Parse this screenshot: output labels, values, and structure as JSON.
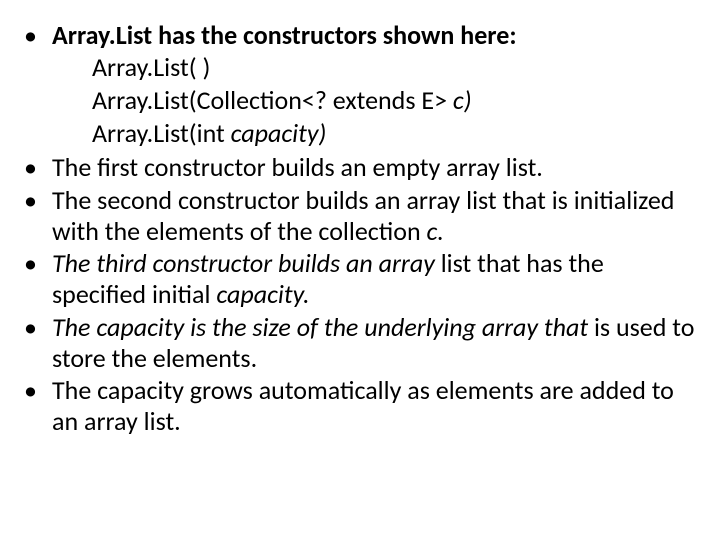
{
  "bullets": {
    "b0": {
      "lead_bold": "Array.",
      "lead_rest": "List has the constructors shown here:",
      "sub1_a": "Array.",
      "sub1_b": "List( )",
      "sub2_a": "Array.",
      "sub2_b": "List(Collection<? extends E> ",
      "sub2_c": "c)",
      "sub3_a": "Array.",
      "sub3_b": "List(int ",
      "sub3_c": "capacity)"
    },
    "b1": "The first constructor builds an empty array list.",
    "b2": {
      "a": "The second constructor builds an array list that is initialized with the elements of the collection ",
      "b": "c."
    },
    "b3": {
      "a": "The third constructor builds an array ",
      "b": "list that has the specified initial ",
      "c": "capacity."
    },
    "b4": {
      "a": "The capacity is the size of the underlying array that ",
      "b": "is used to store the elements."
    },
    "b5": "The capacity grows automatically as elements are added to an array list."
  }
}
